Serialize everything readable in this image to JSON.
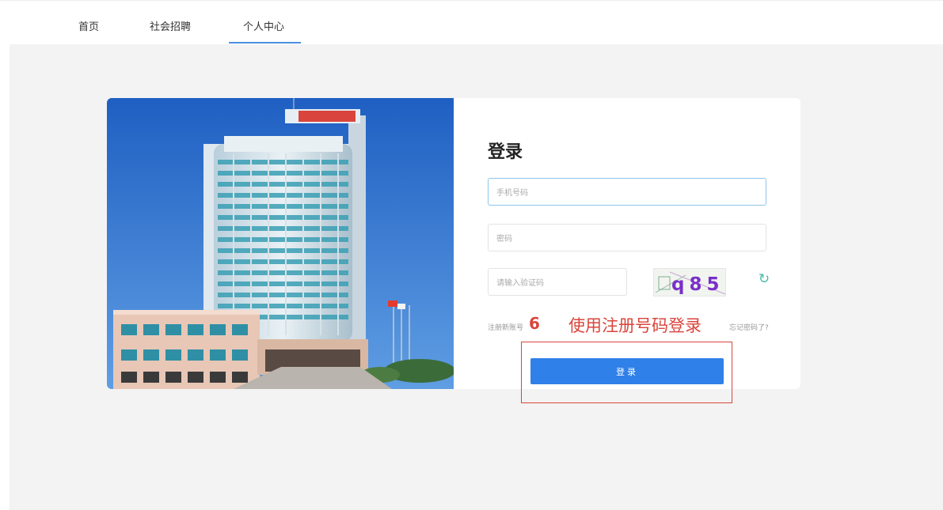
{
  "nav": {
    "items": [
      {
        "label": "首页"
      },
      {
        "label": "社会招聘"
      },
      {
        "label": "个人中心"
      }
    ],
    "active_index": 2
  },
  "login": {
    "title": "登录",
    "phone_placeholder": "手机号码",
    "password_placeholder": "密码",
    "captcha_placeholder": "请输入验证码",
    "captcha_text": "q85",
    "register_link": "注册新账号",
    "forgot_link": "忘记密码了?",
    "submit_label": "登录"
  },
  "annotation": {
    "step_number": "6",
    "instruction": "使用注册号码登录"
  },
  "colors": {
    "accent": "#2f80e8",
    "annotation": "#d9453c",
    "nav_underline": "#4a90e2"
  }
}
